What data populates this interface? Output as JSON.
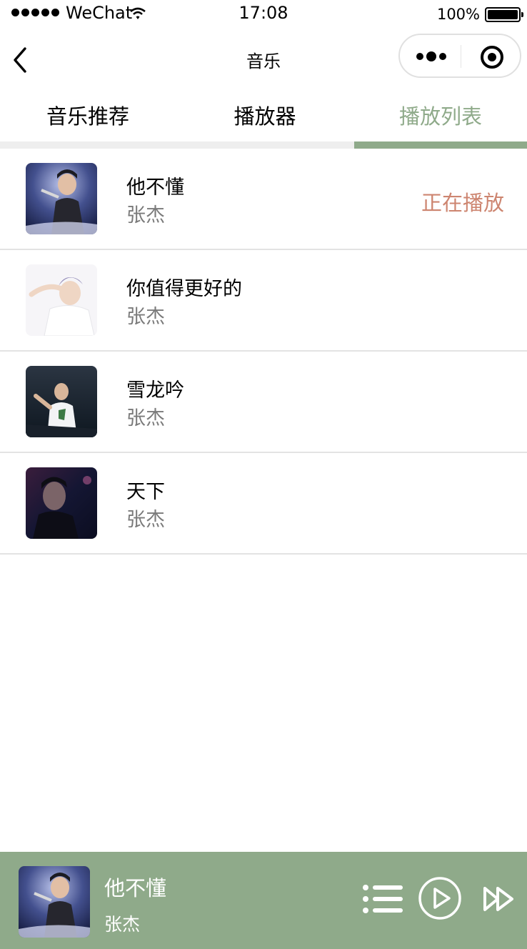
{
  "status_bar": {
    "carrier": "WeChat",
    "time": "17:08",
    "battery": "100%"
  },
  "nav": {
    "title": "音乐"
  },
  "tabs": [
    {
      "label": "音乐推荐",
      "active": false
    },
    {
      "label": "播放器",
      "active": false
    },
    {
      "label": "播放列表",
      "active": true
    }
  ],
  "playlist": [
    {
      "title": "他不懂",
      "artist": "张杰",
      "status": "正在播放"
    },
    {
      "title": "你值得更好的",
      "artist": "张杰",
      "status": ""
    },
    {
      "title": "雪龙吟",
      "artist": "张杰",
      "status": ""
    },
    {
      "title": "天下",
      "artist": "张杰",
      "status": ""
    }
  ],
  "player": {
    "title": "他不懂",
    "artist": "张杰"
  },
  "colors": {
    "accent": "#8faa8a",
    "now_playing": "#cd8570",
    "artist_text": "#7a7a7a"
  },
  "icons": [
    "back-arrow-icon",
    "more-icon",
    "close-target-icon",
    "playlist-icon",
    "play-icon",
    "next-icon"
  ]
}
